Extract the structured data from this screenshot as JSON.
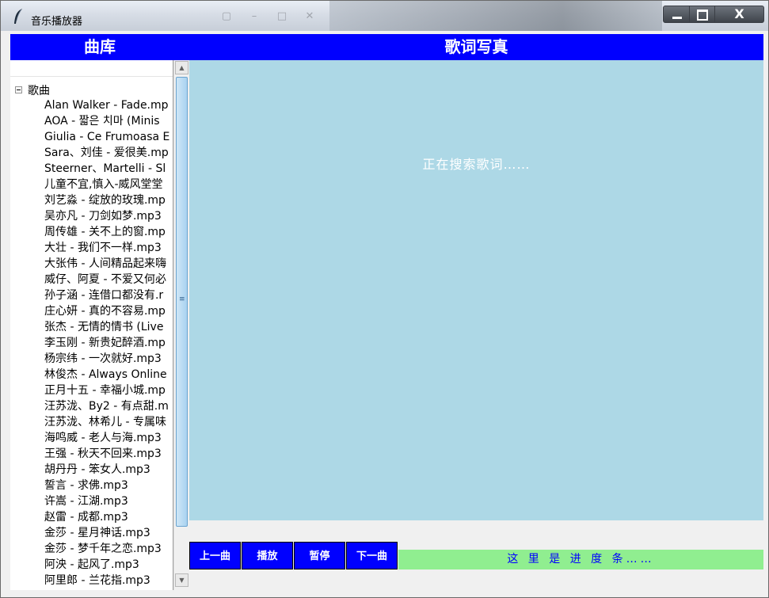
{
  "window": {
    "title": "音乐播放器",
    "controls": {
      "close_label": "X"
    }
  },
  "header": {
    "library_label": "曲库",
    "lyrics_label": "歌词写真"
  },
  "library": {
    "root_label": "歌曲",
    "songs": [
      "Alan Walker - Fade.mp",
      "AOA - 짧은 치마 (Minis",
      "Giulia - Ce Frumoasa E",
      "Sara、刘佳 - 爱很美.mp",
      "Steerner、Martelli - Sl",
      "儿童不宜,慎入-威风堂堂",
      "刘艺淼 - 绽放的玫瑰.mp",
      "吴亦凡 - 刀剑如梦.mp3",
      "周传雄 - 关不上的窗.mp",
      "大壮 - 我们不一样.mp3",
      "大张伟 - 人间精品起来嗨",
      "威仔、阿夏 - 不爱又何必",
      "孙子涵 - 连借口都没有.r",
      "庄心妍 - 真的不容易.mp",
      "张杰 - 无情的情书 (Live",
      "李玉刚 - 新贵妃醉酒.mp",
      "杨宗纬 - 一次就好.mp3",
      "林俊杰 - Always Online",
      "正月十五 - 幸福小城.mp",
      "汪苏泷、By2 - 有点甜.m",
      "汪苏泷、林希儿 - 专属味",
      "海鸣威 - 老人与海.mp3",
      "王强 - 秋天不回来.mp3",
      "胡丹丹 - 笨女人.mp3",
      "誓言 - 求佛.mp3",
      "许嵩 - 江湖.mp3",
      "赵雷 - 成都.mp3",
      "金莎 - 星月神话.mp3",
      "金莎 - 梦千年之恋.mp3",
      "阿泱 - 起风了.mp3",
      "阿里郎 - 兰花指.mp3"
    ]
  },
  "lyrics": {
    "status_text": "正在搜索歌词……"
  },
  "controls": {
    "prev_label": "上一曲",
    "play_label": "播放",
    "pause_label": "暂停",
    "next_label": "下一曲"
  },
  "progress": {
    "text": "这 里 是 进 度 条……"
  },
  "colors": {
    "header_bg": "#0000ff",
    "lyrics_bg": "#add8e6",
    "progress_bg": "#90ee90",
    "button_bg": "#0000ff"
  }
}
